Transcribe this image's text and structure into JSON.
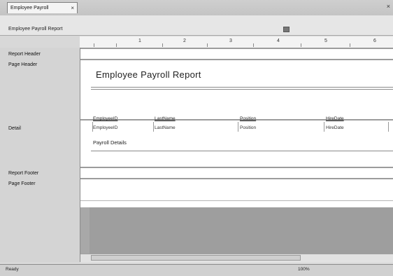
{
  "tab": {
    "title": "Employee Payroll",
    "close_glyph": "×"
  },
  "window": {
    "close_glyph": "×"
  },
  "toolbar": {
    "report_name": "Employee Payroll Report"
  },
  "ruler": {
    "marks": [
      "1",
      "2",
      "3",
      "4",
      "5",
      "6"
    ]
  },
  "sections": {
    "report_header": "Report Header",
    "page_header": "Page Header",
    "detail": "Detail",
    "report_footer": "Report Footer",
    "page_footer": "Page Footer"
  },
  "report": {
    "title": "Employee Payroll Report",
    "columns": [
      {
        "label": "EmployeeID",
        "value": "EmployeeID"
      },
      {
        "label": "LastName",
        "value": "LastName"
      },
      {
        "label": "Position",
        "value": "Position"
      },
      {
        "label": "HireDate",
        "value": "HireDate"
      }
    ],
    "details_label": "Payroll Details"
  },
  "status": {
    "left": "Ready",
    "right": "100%"
  }
}
